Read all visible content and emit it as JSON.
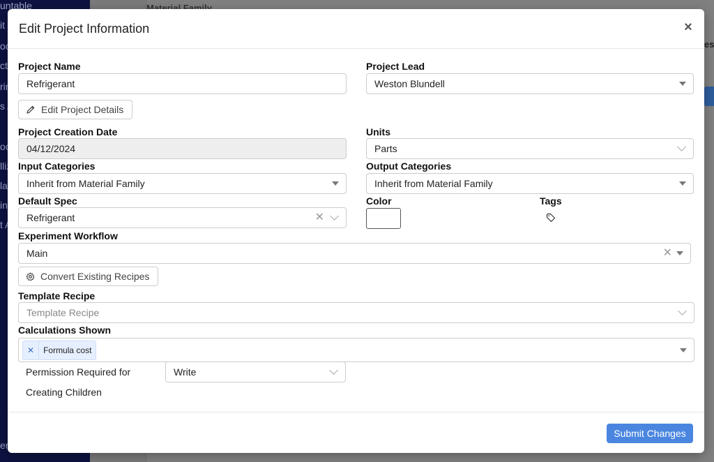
{
  "background": {
    "sidebar_fragments": [
      "untable",
      "it",
      "oc",
      "ct",
      "rin",
      "s A",
      "oc",
      "lliz",
      "la",
      "in",
      "t A",
      "er"
    ],
    "main_title": "Material Family",
    "right_fragment": "es"
  },
  "modal": {
    "title": "Edit Project Information",
    "close_label": "×"
  },
  "form": {
    "project_name": {
      "label": "Project Name",
      "value": "Refrigerant"
    },
    "project_lead": {
      "label": "Project Lead",
      "value": "Weston Blundell"
    },
    "edit_details_button": "Edit Project Details",
    "creation_date": {
      "label": "Project Creation Date",
      "value": "04/12/2024"
    },
    "units": {
      "label": "Units",
      "value": "Parts"
    },
    "input_categories": {
      "label": "Input Categories",
      "value": "Inherit from Material Family"
    },
    "output_categories": {
      "label": "Output Categories",
      "value": "Inherit from Material Family"
    },
    "default_spec": {
      "label": "Default Spec",
      "value": "Refrigerant"
    },
    "color": {
      "label": "Color"
    },
    "tags": {
      "label": "Tags"
    },
    "experiment_workflow": {
      "label": "Experiment Workflow",
      "value": "Main"
    },
    "convert_recipes_button": "Convert Existing Recipes",
    "template_recipe": {
      "label": "Template Recipe",
      "placeholder": "Template Recipe"
    },
    "calculations_shown": {
      "label": "Calculations Shown",
      "chips": [
        "Formula cost"
      ]
    },
    "permission": {
      "label_line1": "Permission Required for",
      "label_line2": "Creating Children",
      "value": "Write"
    }
  },
  "footer": {
    "submit_label": "Submit Changes"
  },
  "colors": {
    "primary": "#4a86e0",
    "sidebar": "#0d1240",
    "chip_bg": "#e6efff"
  }
}
